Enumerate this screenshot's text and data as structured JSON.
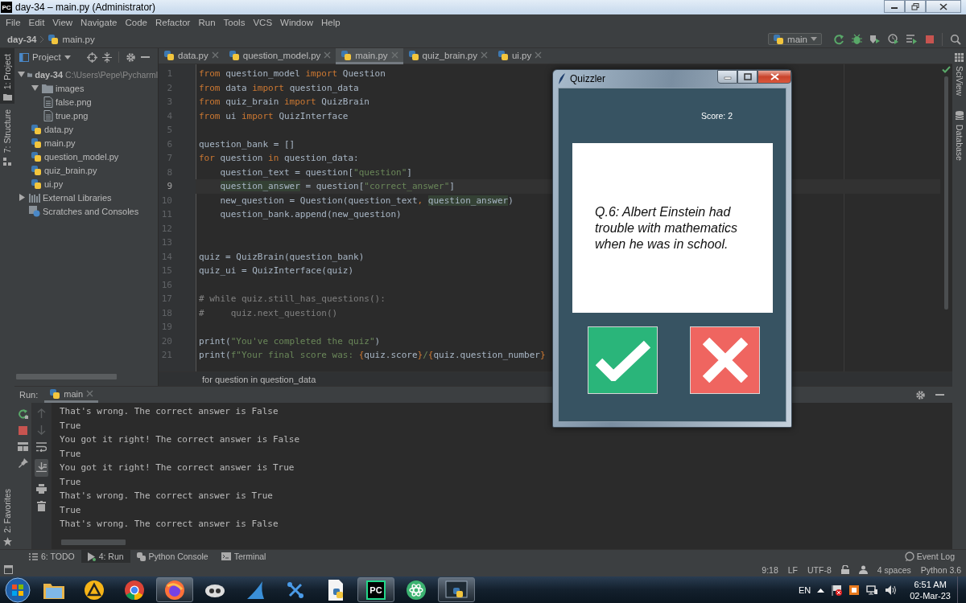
{
  "window": {
    "logo": "PC",
    "title": "day-34 – main.py (Administrator)"
  },
  "menu": [
    "File",
    "Edit",
    "View",
    "Navigate",
    "Code",
    "Refactor",
    "Run",
    "Tools",
    "VCS",
    "Window",
    "Help"
  ],
  "navbar": {
    "project": "day-34",
    "file": "main.py",
    "run_config": "main"
  },
  "left_strip": {
    "top": [
      {
        "label": "1: Project",
        "selected": true
      },
      {
        "label": "7: Structure",
        "selected": false
      }
    ],
    "bottom": [
      {
        "label": "2: Favorites",
        "selected": false
      }
    ]
  },
  "right_strip": [
    "SciView",
    "Database"
  ],
  "project": {
    "title": "Project",
    "tree": [
      {
        "label": "day-34",
        "hint": "C:\\Users\\Pepe\\Pycharml",
        "kind": "folder",
        "expanded": true,
        "children": [
          {
            "label": "images",
            "kind": "folder",
            "expanded": true,
            "children": [
              {
                "label": "false.png",
                "kind": "image"
              },
              {
                "label": "true.png",
                "kind": "image"
              }
            ]
          },
          {
            "label": "data.py",
            "kind": "python"
          },
          {
            "label": "main.py",
            "kind": "python"
          },
          {
            "label": "question_model.py",
            "kind": "python"
          },
          {
            "label": "quiz_brain.py",
            "kind": "python"
          },
          {
            "label": "ui.py",
            "kind": "python"
          }
        ]
      },
      {
        "label": "External Libraries",
        "kind": "library",
        "expanded": false
      },
      {
        "label": "Scratches and Consoles",
        "kind": "scratches"
      }
    ]
  },
  "editor": {
    "tabs": [
      {
        "label": "data.py",
        "selected": false
      },
      {
        "label": "question_model.py",
        "selected": false
      },
      {
        "label": "main.py",
        "selected": true
      },
      {
        "label": "quiz_brain.py",
        "selected": false
      },
      {
        "label": "ui.py",
        "selected": false
      }
    ],
    "lines": [
      {
        "number": "1",
        "current": false,
        "tokens": [
          {
            "kind": "keyword",
            "text": "from"
          },
          {
            "kind": "plain",
            "text": " question_model "
          },
          {
            "kind": "keyword",
            "text": "import"
          },
          {
            "kind": "plain",
            "text": " Question"
          }
        ]
      },
      {
        "number": "2",
        "current": false,
        "tokens": [
          {
            "kind": "keyword",
            "text": "from"
          },
          {
            "kind": "plain",
            "text": " data "
          },
          {
            "kind": "keyword",
            "text": "import"
          },
          {
            "kind": "plain",
            "text": " question_data"
          }
        ]
      },
      {
        "number": "3",
        "current": false,
        "tokens": [
          {
            "kind": "keyword",
            "text": "from"
          },
          {
            "kind": "plain",
            "text": " quiz_brain "
          },
          {
            "kind": "keyword",
            "text": "import"
          },
          {
            "kind": "plain",
            "text": " QuizBrain"
          }
        ]
      },
      {
        "number": "4",
        "current": false,
        "tokens": [
          {
            "kind": "keyword",
            "text": "from"
          },
          {
            "kind": "plain",
            "text": " ui "
          },
          {
            "kind": "keyword",
            "text": "import"
          },
          {
            "kind": "plain",
            "text": " QuizInterface"
          }
        ]
      },
      {
        "number": "5",
        "current": false
      },
      {
        "number": "6",
        "current": false,
        "tokens": [
          {
            "kind": "plain",
            "text": "question_bank = []"
          }
        ]
      },
      {
        "number": "7",
        "current": false,
        "tokens": [
          {
            "kind": "keyword",
            "text": "for"
          },
          {
            "kind": "plain",
            "text": " question "
          },
          {
            "kind": "keyword",
            "text": "in"
          },
          {
            "kind": "plain",
            "text": " question_data:"
          }
        ]
      },
      {
        "number": "8",
        "current": false,
        "tokens": [
          {
            "kind": "plain",
            "text": "    question_text = question["
          },
          {
            "kind": "string",
            "text": "\"question\""
          },
          {
            "kind": "plain",
            "text": "]"
          }
        ]
      },
      {
        "number": "9",
        "current": true,
        "tokens": [
          {
            "kind": "usage",
            "text": "    question_answer"
          },
          {
            "kind": "plain",
            "text": " = question["
          },
          {
            "kind": "string",
            "text": "\"correct_answer\""
          },
          {
            "kind": "plain",
            "text": "]"
          }
        ]
      },
      {
        "number": "10",
        "current": false,
        "tokens": [
          {
            "kind": "plain",
            "text": "    new_question = Question(question_text"
          },
          {
            "kind": "keyword",
            "text": ", "
          },
          {
            "kind": "usage",
            "text": "question_answer"
          },
          {
            "kind": "plain",
            "text": ")"
          }
        ]
      },
      {
        "number": "11",
        "current": false,
        "tokens": [
          {
            "kind": "plain",
            "text": "    question_bank.append(new_question)"
          }
        ]
      },
      {
        "number": "12",
        "current": false
      },
      {
        "number": "13",
        "current": false
      },
      {
        "number": "14",
        "current": false,
        "tokens": [
          {
            "kind": "plain",
            "text": "quiz = QuizBrain(question_bank)"
          }
        ]
      },
      {
        "number": "15",
        "current": false,
        "tokens": [
          {
            "kind": "plain",
            "text": "quiz_ui = QuizInterface(quiz)"
          }
        ]
      },
      {
        "number": "16",
        "current": false
      },
      {
        "number": "17",
        "current": false,
        "tokens": [
          {
            "kind": "comment",
            "text": "# while quiz.still_has_questions():"
          }
        ]
      },
      {
        "number": "18",
        "current": false,
        "tokens": [
          {
            "kind": "comment",
            "text": "#     quiz.next_question()"
          }
        ]
      },
      {
        "number": "19",
        "current": false
      },
      {
        "number": "20",
        "current": false,
        "tokens": [
          {
            "kind": "plain",
            "text": "print("
          },
          {
            "kind": "string",
            "text": "\"You've completed the quiz\""
          },
          {
            "kind": "plain",
            "text": ")"
          }
        ]
      },
      {
        "number": "21",
        "current": false,
        "tokens": [
          {
            "kind": "plain",
            "text": "print("
          },
          {
            "kind": "string",
            "text": "f\"Your final score was: "
          },
          {
            "kind": "keyword",
            "text": "{"
          },
          {
            "kind": "plain",
            "text": "quiz.score"
          },
          {
            "kind": "keyword",
            "text": "}"
          },
          {
            "kind": "string",
            "text": "/"
          },
          {
            "kind": "keyword",
            "text": "{"
          },
          {
            "kind": "plain",
            "text": "quiz.question_number"
          },
          {
            "kind": "keyword",
            "text": "}"
          }
        ]
      }
    ],
    "breadcrumb": "for question in question_data"
  },
  "run": {
    "title": "Run:",
    "tab": "main",
    "output": [
      "That's wrong. The correct answer is False",
      "True",
      "You got it right! The correct answer is False",
      "True",
      "You got it right! The correct answer is True",
      "True",
      "That's wrong. The correct answer is True",
      "True",
      "That's wrong. The correct answer is False"
    ]
  },
  "tool_tabs": [
    {
      "label": "6: TODO",
      "kind": "list",
      "selected": false
    },
    {
      "label": "4: Run",
      "kind": "run",
      "selected": true
    },
    {
      "label": "Python Console",
      "kind": "python",
      "selected": false
    },
    {
      "label": "Terminal",
      "kind": "terminal",
      "selected": false
    }
  ],
  "event_log": "Event Log",
  "status": {
    "position": "9:18",
    "line_separator": "LF",
    "encoding": "UTF-8",
    "indent": "4 spaces",
    "interpreter": "Python 3.6"
  },
  "quizzler": {
    "title": "Quizzler",
    "score": "Score: 2",
    "question": "Q.6: Albert Einstein had trouble with mathematics when he was in school."
  },
  "taskbar": {
    "apps": [
      {
        "kind": "folder",
        "running": false
      },
      {
        "kind": "triangle",
        "running": false
      },
      {
        "kind": "wheel",
        "running": false
      },
      {
        "kind": "swirl",
        "running": true
      },
      {
        "kind": "cloud",
        "running": false
      },
      {
        "kind": "fin",
        "running": false
      },
      {
        "kind": "nodes",
        "running": false
      },
      {
        "kind": "document",
        "running": false
      },
      {
        "kind": "logo",
        "label": "PC",
        "running": true
      },
      {
        "kind": "atom",
        "running": false
      },
      {
        "kind": "terminal",
        "running": true
      }
    ],
    "language": "EN",
    "time": "6:51 AM",
    "date": "02-Mar-23"
  }
}
